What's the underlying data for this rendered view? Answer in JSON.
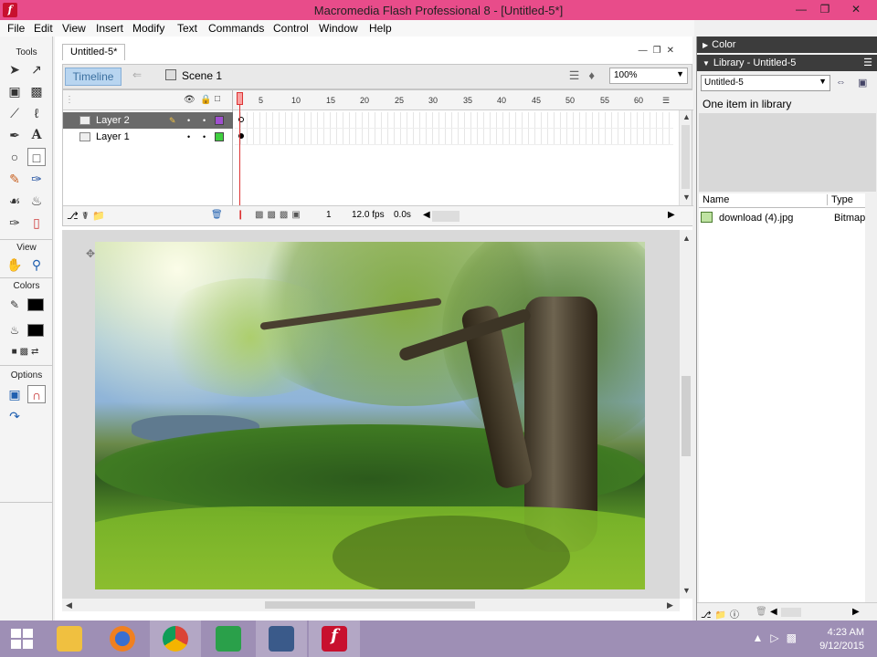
{
  "window": {
    "title": "Macromedia Flash Professional 8 - [Untitled-5*]",
    "controls": [
      "minimize",
      "maximize",
      "close"
    ]
  },
  "menu": [
    "File",
    "Edit",
    "View",
    "Insert",
    "Modify",
    "Text",
    "Commands",
    "Control",
    "Window",
    "Help"
  ],
  "tools": {
    "title": "Tools",
    "view_label": "View",
    "colors_label": "Colors",
    "options_label": "Options"
  },
  "document": {
    "tab": "Untitled-5*",
    "timeline_button": "Timeline",
    "scene": "Scene 1",
    "zoom": "100%"
  },
  "timeline": {
    "ruler_ticks": [
      "5",
      "10",
      "15",
      "20",
      "25",
      "30",
      "35",
      "40",
      "45",
      "50",
      "55",
      "60"
    ],
    "layers": [
      {
        "name": "Layer 2",
        "selected": true,
        "color": "#a050d0"
      },
      {
        "name": "Layer 1",
        "selected": false,
        "color": "#40d040"
      }
    ],
    "current_frame": "1",
    "frame_rate": "12.0 fps",
    "elapsed": "0.0s"
  },
  "library": {
    "color_panel_title": "Color",
    "panel_title": "Library - Untitled-5",
    "document_select": "Untitled-5",
    "item_count": "One item in library",
    "col_name": "Name",
    "col_type": "Type",
    "items": [
      {
        "name": "download (4).jpg",
        "type": "Bitmap"
      }
    ]
  },
  "taskbar": {
    "time": "4:23 AM",
    "date": "9/12/2015",
    "apps": [
      "start",
      "file-explorer",
      "firefox",
      "chrome",
      "store",
      "video-recorder",
      "flash"
    ]
  },
  "colors": {
    "titlebar": "#e84c8a",
    "taskbar": "#9e8fb5",
    "timeline_button": "#b8d5f0"
  }
}
